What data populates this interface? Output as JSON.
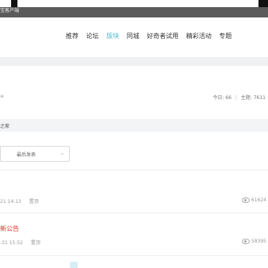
{
  "topbar": {
    "title": "宝客户端"
  },
  "nav": {
    "items": [
      {
        "label": "推荐"
      },
      {
        "label": "论坛"
      },
      {
        "label": "版块",
        "active": true
      },
      {
        "label": "同城"
      },
      {
        "label": "好奇者试用"
      },
      {
        "label": "精彩活动"
      },
      {
        "label": "专题"
      }
    ]
  },
  "forum": {
    "mark": "≡",
    "today_label": "今日: 66",
    "sep": "|",
    "topics_label": "主题: 7611"
  },
  "section": {
    "title": "之家"
  },
  "sort": {
    "selected": "最后发表",
    "chevron": "⌄"
  },
  "threads": [
    {
      "title": "",
      "date": "21 14:13",
      "page": "置顶",
      "views": "61624"
    },
    {
      "title": "新公告",
      "date": "-31 15:52",
      "page": "置顶",
      "views": "58395"
    }
  ],
  "colors": {
    "accent": "#4fb7cf",
    "highlight": "#e0302b"
  }
}
